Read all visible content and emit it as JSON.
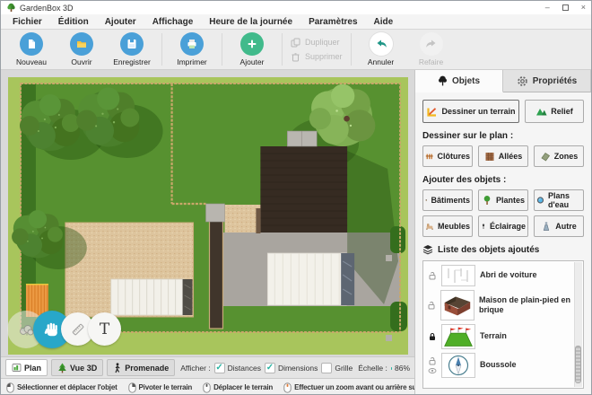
{
  "window": {
    "title": "GardenBox 3D"
  },
  "icons": {
    "minimize": "–",
    "close": "×",
    "check": "✓",
    "text_tool": "T"
  },
  "menu": {
    "items": [
      "Fichier",
      "Édition",
      "Ajouter",
      "Affichage",
      "Heure de la journée",
      "Paramètres",
      "Aide"
    ]
  },
  "toolbar": {
    "nouveau": "Nouveau",
    "ouvrir": "Ouvrir",
    "enregistrer": "Enregistrer",
    "imprimer": "Imprimer",
    "ajouter": "Ajouter",
    "dupliquer": "Dupliquer",
    "supprimer": "Supprimer",
    "annuler": "Annuler",
    "refaire": "Refaire"
  },
  "panel": {
    "tab_objects": "Objets",
    "tab_properties": "Propriétés",
    "draw_terrain": "Dessiner un terrain",
    "relief": "Relief",
    "draw_heading": "Dessiner sur le plan :",
    "clotures": "Clôtures",
    "allees": "Allées",
    "zones": "Zones",
    "objects_heading": "Ajouter des objets :",
    "batiments": "Bâtiments",
    "plantes": "Plantes",
    "plans_eau": "Plans d'eau",
    "meubles": "Meubles",
    "eclairage": "Éclairage",
    "autre": "Autre",
    "list_heading": "Liste des objets ajoutés",
    "list_items": [
      {
        "label": "Abri de voiture"
      },
      {
        "label": "Maison de plain-pied en brique"
      },
      {
        "label": "Terrain"
      },
      {
        "label": "Boussole"
      }
    ]
  },
  "bottom_bar": {
    "plan": "Plan",
    "vue3d": "Vue 3D",
    "promenade": "Promenade",
    "afficher": "Afficher :",
    "distances": "Distances",
    "dimensions": "Dimensions",
    "grille": "Grille",
    "echelle": "Échelle :",
    "scale_value": "86%",
    "scale_percent": 86
  },
  "status_bar": {
    "hints": [
      "Sélectionner et déplacer l'objet",
      "Pivoter le terrain",
      "Déplacer le terrain",
      "Effectuer un zoom avant ou arrière sur le terrain"
    ]
  },
  "colors": {
    "accent_teal": "#2ab3a2",
    "toolbar_blue": "#4aa0d8",
    "add_green": "#41ba8b",
    "hand_blue": "#28a7c9",
    "lawn_light": "#a8c55c",
    "lawn_dark": "#579130"
  }
}
